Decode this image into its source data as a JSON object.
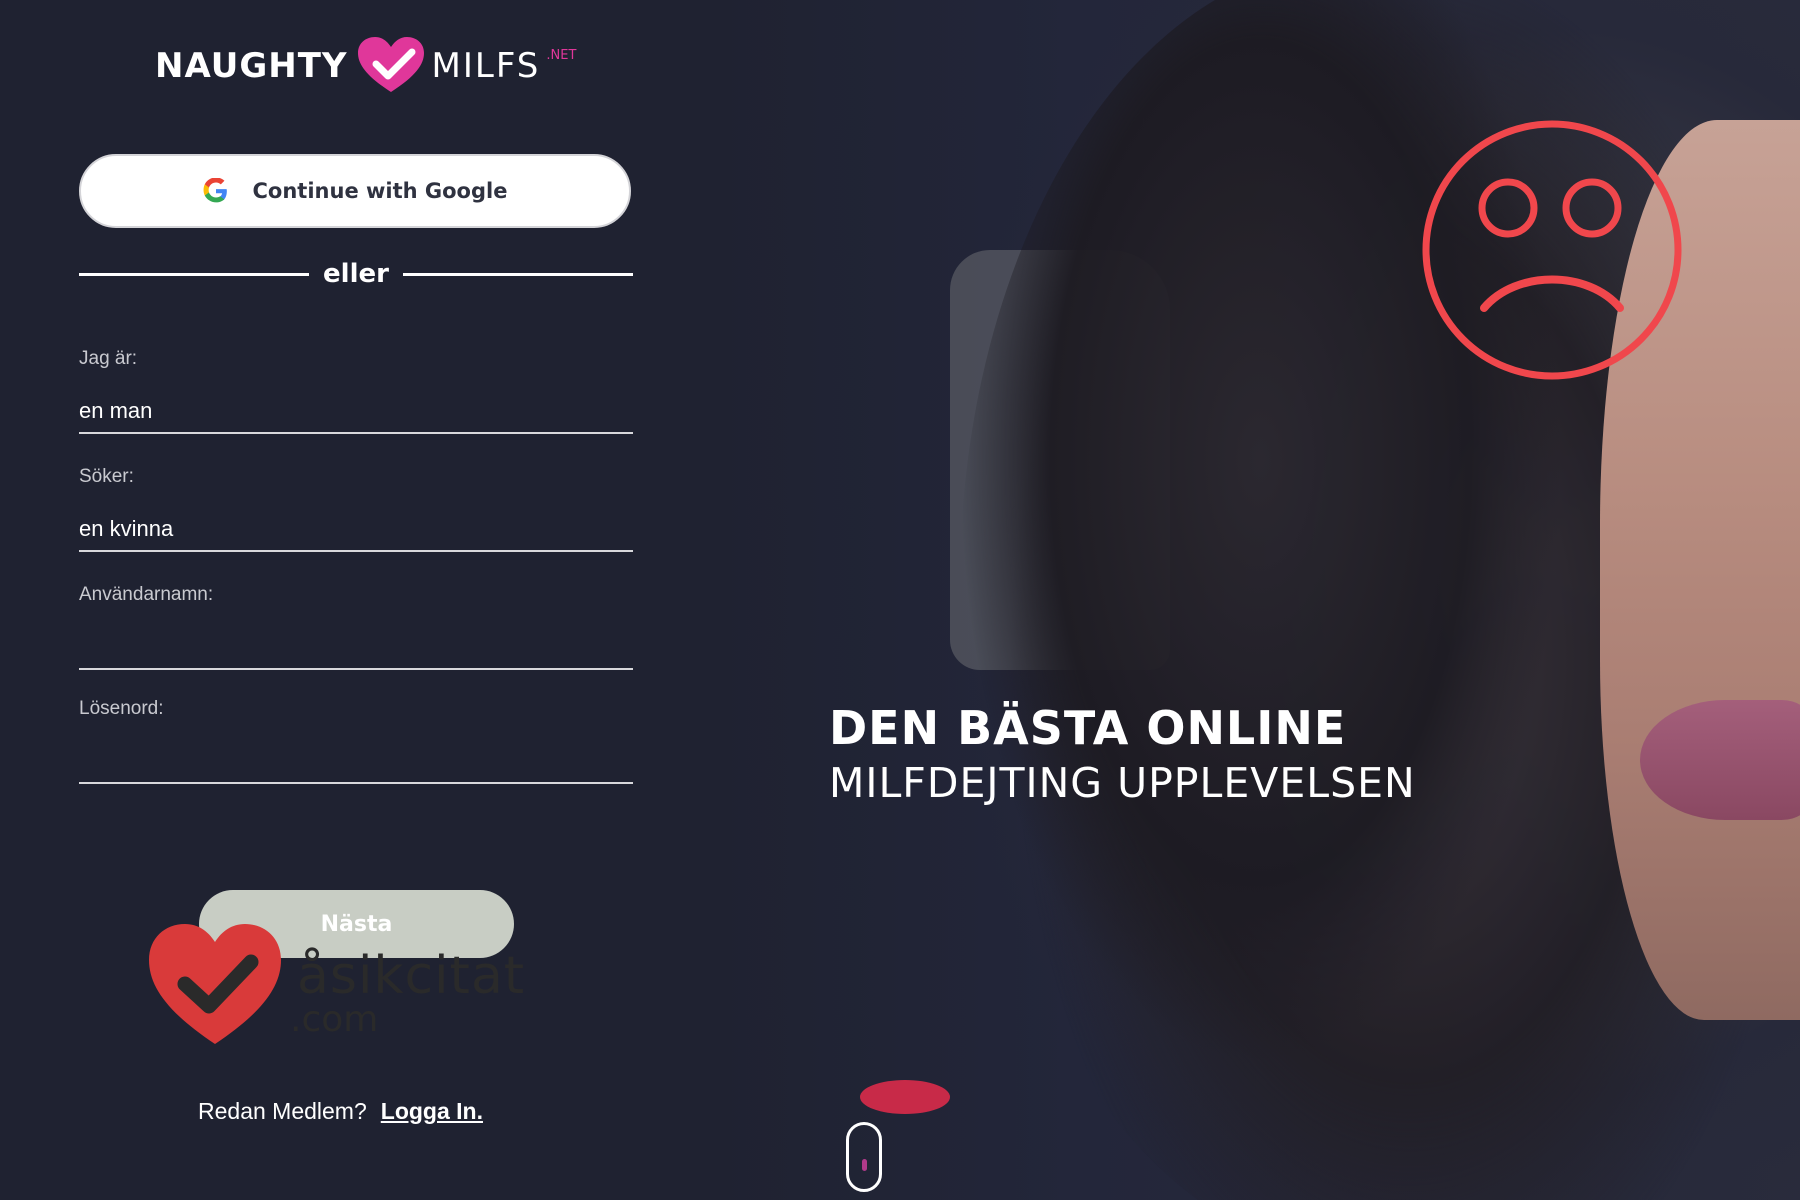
{
  "logo": {
    "word_left": "NAUGHTY",
    "word_right": "MILFS",
    "suffix": ".NET",
    "heart_color": "#e0379a"
  },
  "signup": {
    "google_label": "Continue with Google",
    "google_icon": "google-g-icon",
    "divider_text": "eller",
    "fields": {
      "gender": {
        "label": "Jag är:",
        "value": "en man"
      },
      "seeking": {
        "label": "Söker:",
        "value": "en kvinna"
      },
      "username": {
        "label": "Användarnamn:",
        "value": ""
      },
      "password": {
        "label": "Lösenord:",
        "value": ""
      }
    },
    "next_label": "Nästa",
    "member_prompt": "Redan Medlem?",
    "login_link": "Logga In."
  },
  "hero": {
    "headline_bold": "DEN BÄSTA ONLINE",
    "headline_regular": "MILFDEJTING UPPLEVELSEN",
    "scroll_icon": "mouse-scroll-icon"
  },
  "overlays": {
    "sad_face_icon": "sad-face-icon",
    "sad_face_color": "#f0474c",
    "watermark_name": "åsikcitat",
    "watermark_tld": ".com",
    "watermark_heart_color": "#d93a3a"
  }
}
